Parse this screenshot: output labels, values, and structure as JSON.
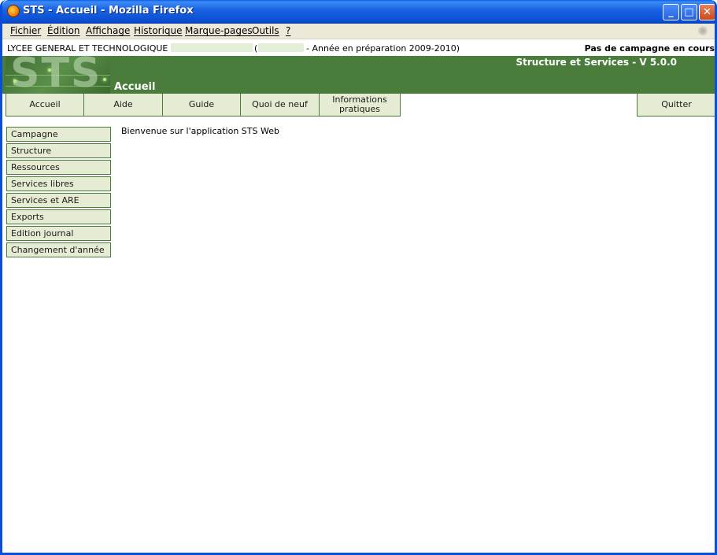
{
  "window": {
    "title": "STS - Accueil - Mozilla Firefox",
    "minimize_label": "_",
    "maximize_label": "□",
    "close_label": "✕"
  },
  "menubar": {
    "items": [
      "Fichier",
      "Édition",
      "Affichage",
      "Historique",
      "Marque-pages",
      "Outils",
      "?"
    ],
    "throbber": "✺"
  },
  "infoline": {
    "school": "LYCEE GENERAL ET TECHNOLOGIQUE",
    "paren_open": "(",
    "year": "- Année en préparation 2009-2010)",
    "campaign": "Pas de campagne en cours"
  },
  "header": {
    "logo_text": "STS",
    "page_title": "Accueil",
    "app_version": "Structure et Services - V 5.0.0"
  },
  "topnav": {
    "tabs": [
      "Accueil",
      "Aide",
      "Guide",
      "Quoi de neuf",
      "Informations pratiques"
    ],
    "quit": "Quitter"
  },
  "sidebar": {
    "items": [
      "Campagne",
      "Structure",
      "Ressources",
      "Services libres",
      "Services et ARE",
      "Exports",
      "Edition journal",
      "Changement d'année"
    ]
  },
  "main": {
    "welcome": "Bienvenue sur l'application STS Web"
  },
  "colors": {
    "brand_green": "#4a7d3c",
    "button_fill": "#e6ecd3",
    "titlebar_blue": "#0b4fd2"
  }
}
